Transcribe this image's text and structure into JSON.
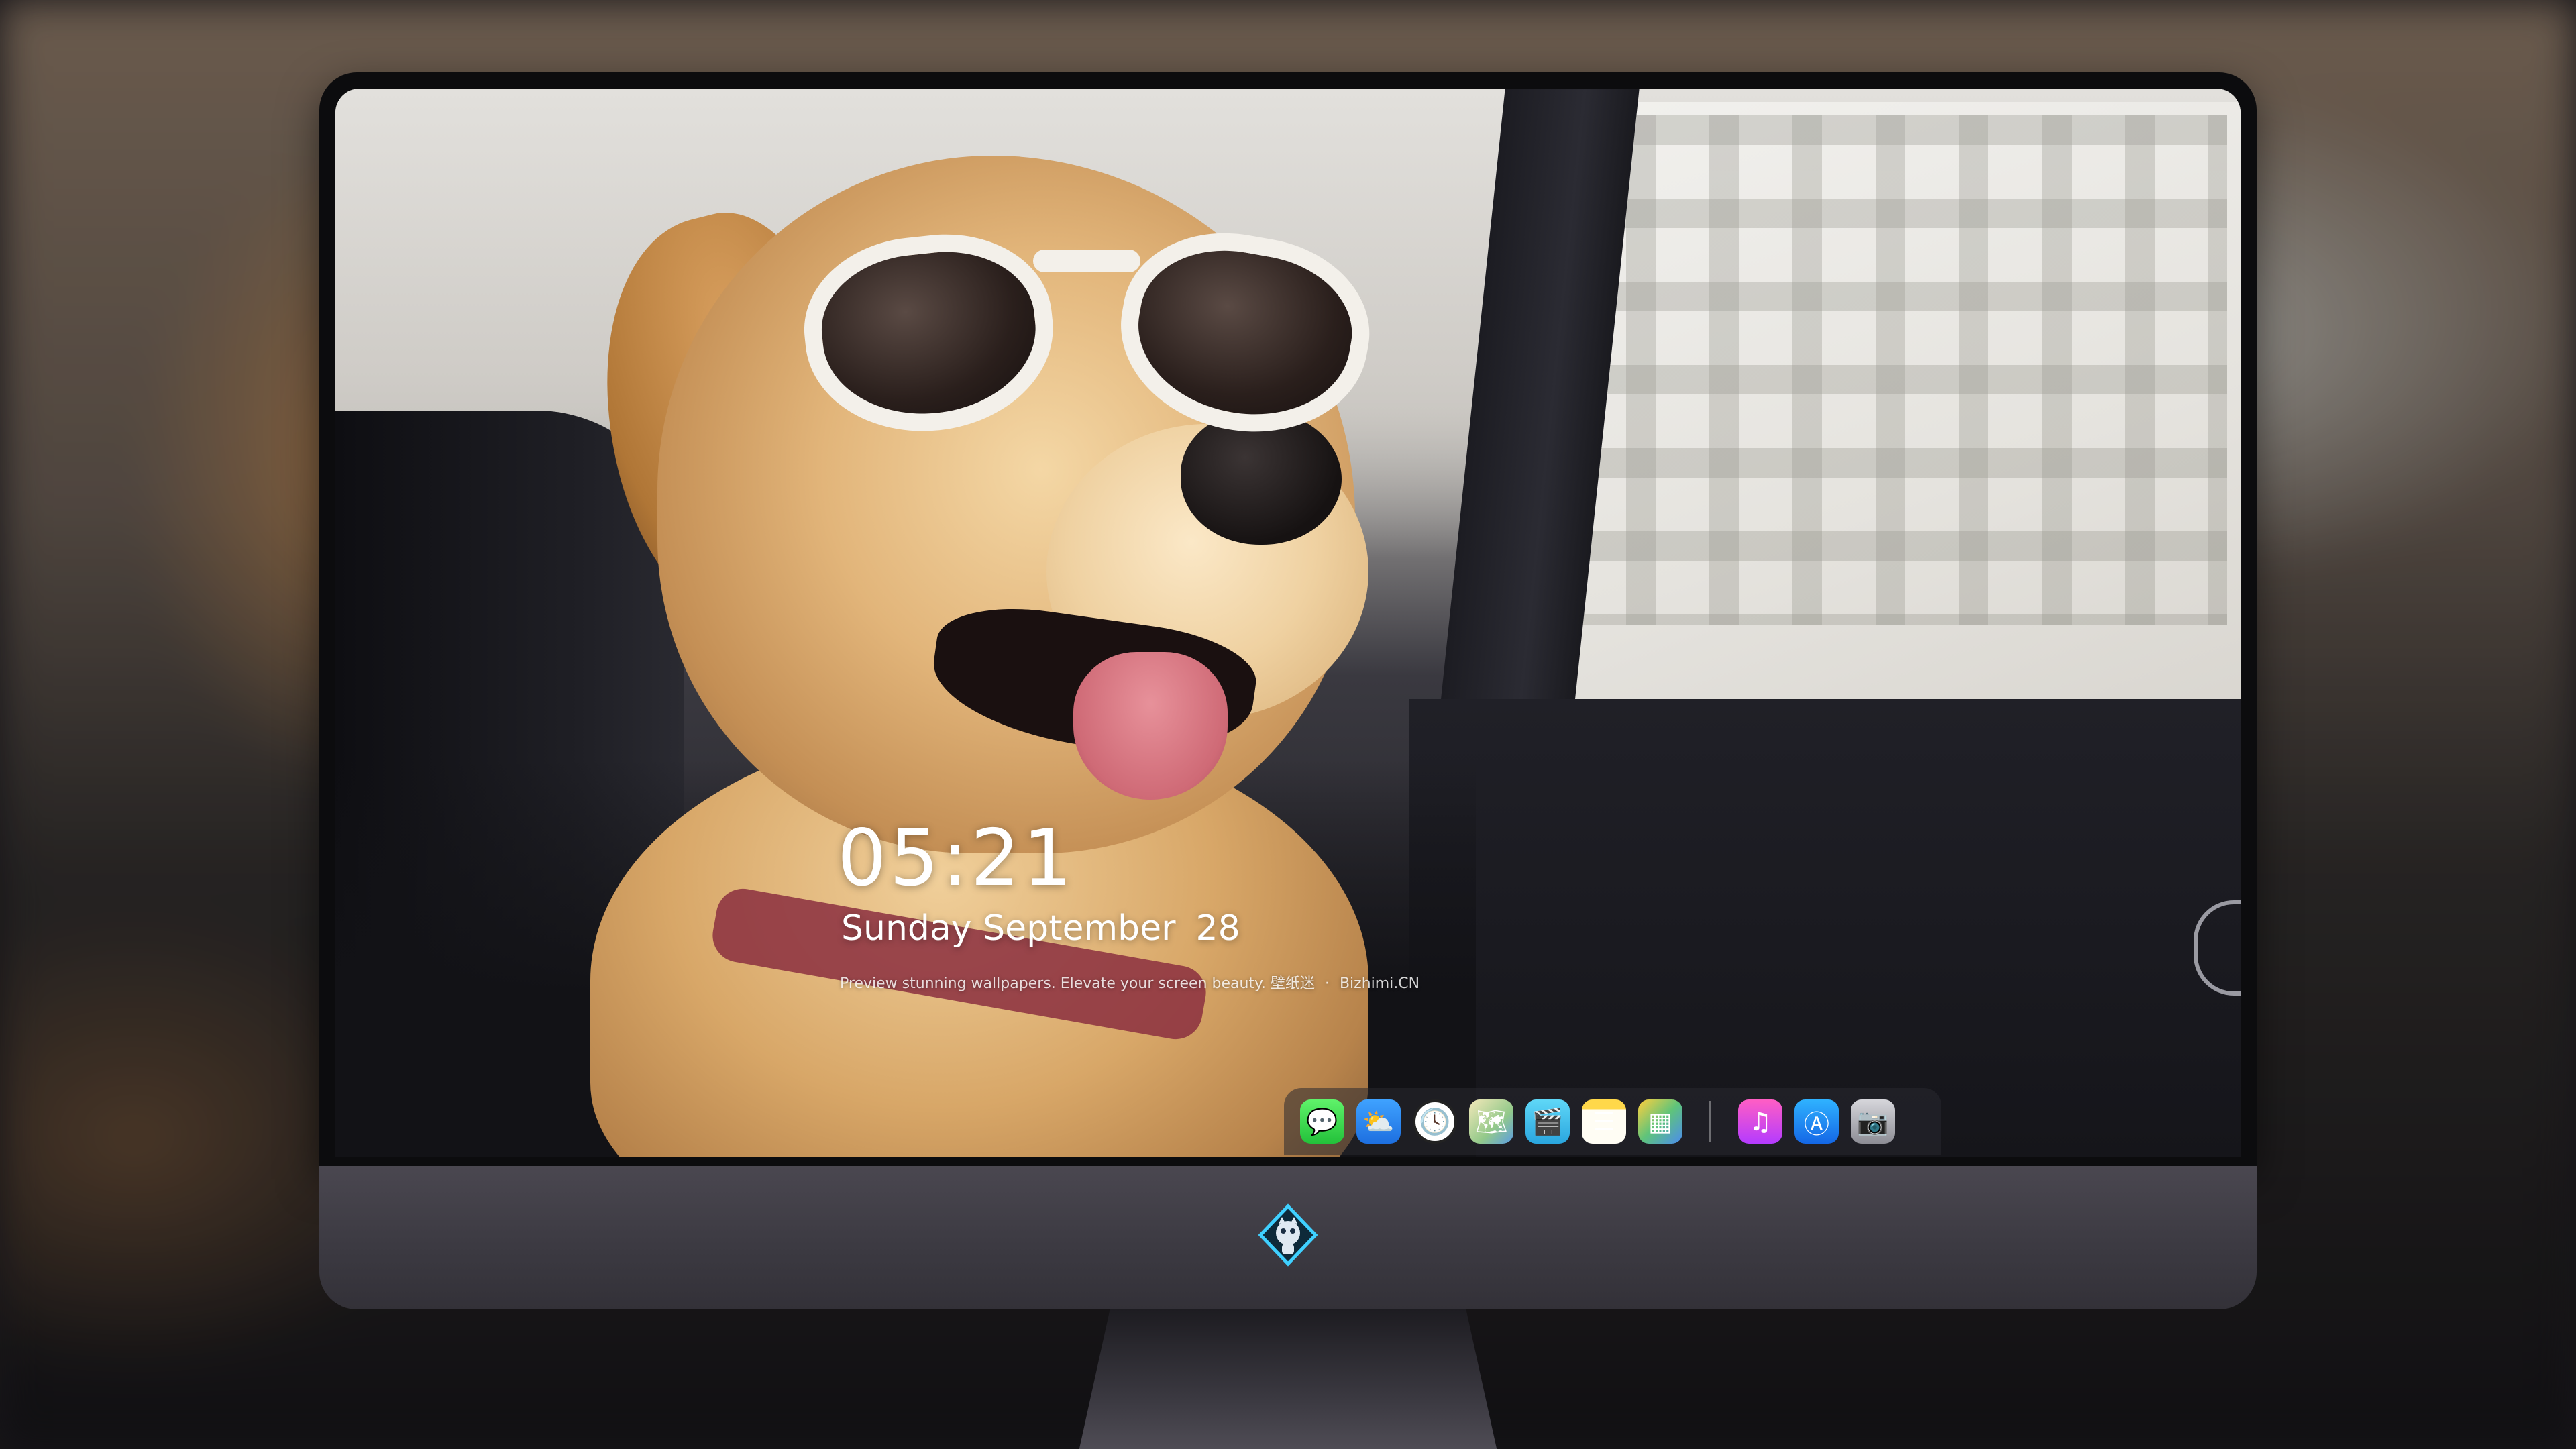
{
  "lock_screen": {
    "time": "05:21",
    "weekday_month": "Sunday September",
    "day": "28",
    "caption_text": "Preview stunning wallpapers. Elevate your screen beauty.",
    "caption_tag": "壁纸迷",
    "caption_separator": "·",
    "caption_site": "Bizhimi.CN"
  },
  "dock": {
    "apps": [
      {
        "name": "messages-icon",
        "glyph": "💬"
      },
      {
        "name": "weather-icon",
        "glyph": "⛅"
      },
      {
        "name": "clock-icon",
        "glyph": "🕓"
      },
      {
        "name": "maps-icon",
        "glyph": "🗺"
      },
      {
        "name": "video-icon",
        "glyph": "🎬"
      },
      {
        "name": "notes-icon",
        "glyph": "☰"
      },
      {
        "name": "photos-icon",
        "glyph": "▦"
      }
    ],
    "pinned": [
      {
        "name": "music-icon",
        "glyph": "♫"
      },
      {
        "name": "app-store-icon",
        "glyph": "Ⓐ"
      },
      {
        "name": "camera-icon",
        "glyph": "📷"
      }
    ]
  },
  "colors": {
    "monitor_chin": "#3b3941",
    "bezel": "#0c0c0e",
    "text": "#ffffff"
  }
}
